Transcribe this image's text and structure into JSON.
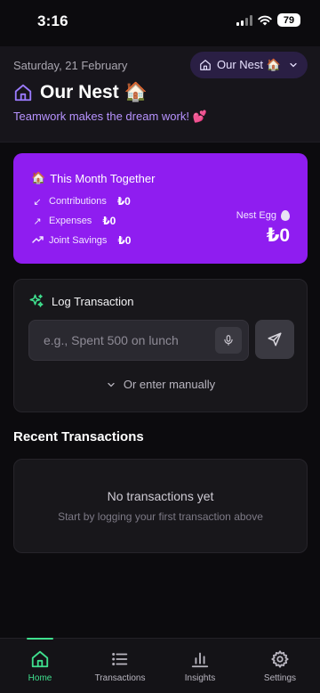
{
  "status_bar": {
    "time": "3:16",
    "battery": "79"
  },
  "header": {
    "date": "Saturday, 21 February",
    "home_switch": {
      "label": "Our Nest",
      "emoji": "🏠"
    },
    "title": "Our Nest",
    "title_emoji": "🏠",
    "tagline": "Teamwork makes the dream work! 💕"
  },
  "summary": {
    "title_emoji": "🏠",
    "title": "This Month Together",
    "rows": [
      {
        "label": "Contributions",
        "amount": "₺0",
        "icon": "arrow-down-left-icon"
      },
      {
        "label": "Expenses",
        "amount": "₺0",
        "icon": "arrow-up-right-icon"
      },
      {
        "label": "Joint Savings",
        "amount": "₺0",
        "icon": "trend-up-icon"
      }
    ],
    "nest_egg_label": "Nest Egg",
    "nest_egg_amount": "₺0"
  },
  "log": {
    "title": "Log Transaction",
    "placeholder": "e.g., Spent 500 on lunch",
    "manual_label": "Or enter manually"
  },
  "recent": {
    "title": "Recent Transactions",
    "empty_title": "No transactions yet",
    "empty_subtitle": "Start by logging your first transaction above"
  },
  "nav": [
    {
      "label": "Home",
      "icon": "home-icon",
      "active": true
    },
    {
      "label": "Transactions",
      "icon": "list-icon",
      "active": false
    },
    {
      "label": "Insights",
      "icon": "bar-chart-icon",
      "active": false
    },
    {
      "label": "Settings",
      "icon": "gear-icon",
      "active": false
    }
  ],
  "colors": {
    "background": "#0c0b0e",
    "accent_purple": "#8f1df0",
    "accent_green": "#3fe08e",
    "tagline": "#b793ff"
  }
}
